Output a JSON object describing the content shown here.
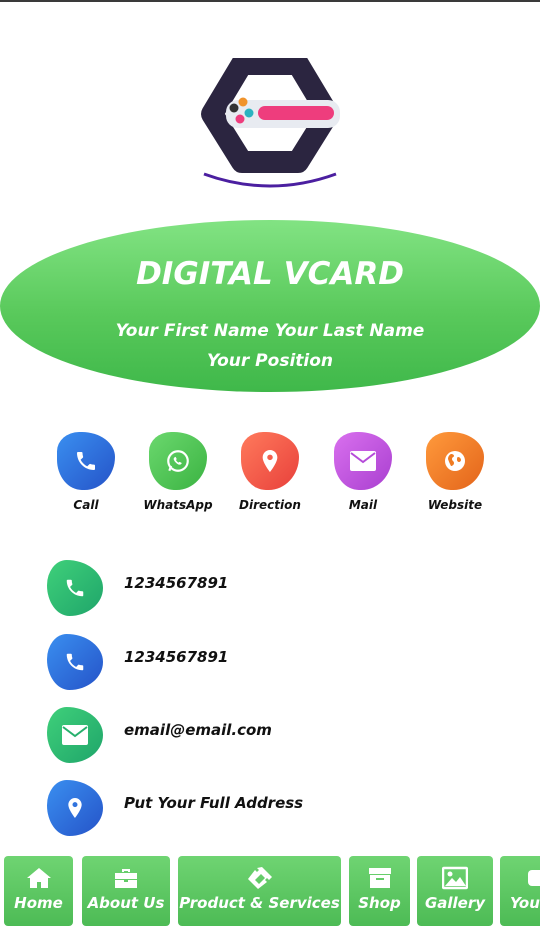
{
  "hero": {
    "title": "DIGITAL VCARD",
    "name_line": "Your First Name Your Last Name",
    "position_line": "Your Position"
  },
  "actions": [
    {
      "label": "Call",
      "icon": "phone-icon",
      "color": "#2f6fe0"
    },
    {
      "label": "WhatsApp",
      "icon": "whatsapp-icon",
      "color": "#4cc24f"
    },
    {
      "label": "Direction",
      "icon": "location-pin-icon",
      "color": "#f25a4a"
    },
    {
      "label": "Mail",
      "icon": "mail-icon",
      "color": "#c957e0"
    },
    {
      "label": "Website",
      "icon": "globe-icon",
      "color": "#f07a1f"
    }
  ],
  "contacts": [
    {
      "text": "1234567891",
      "icon": "phone-icon",
      "color": "#2fbf6f"
    },
    {
      "text": "1234567891",
      "icon": "phone-icon",
      "color": "#2f6fe0"
    },
    {
      "text": "email@email.com",
      "icon": "mail-icon",
      "color": "#2fbf6f"
    },
    {
      "text": "Put Your Full Address",
      "icon": "location-pin-icon",
      "color": "#2f6fe0"
    }
  ],
  "nav": [
    {
      "label": "Home",
      "icon": "home-icon"
    },
    {
      "label": "About Us",
      "icon": "briefcase-icon"
    },
    {
      "label": "Product & Services",
      "icon": "ticket-icon"
    },
    {
      "label": "Shop",
      "icon": "box-icon"
    },
    {
      "label": "Gallery",
      "icon": "image-icon"
    },
    {
      "label": "You",
      "icon": "video-icon"
    }
  ]
}
